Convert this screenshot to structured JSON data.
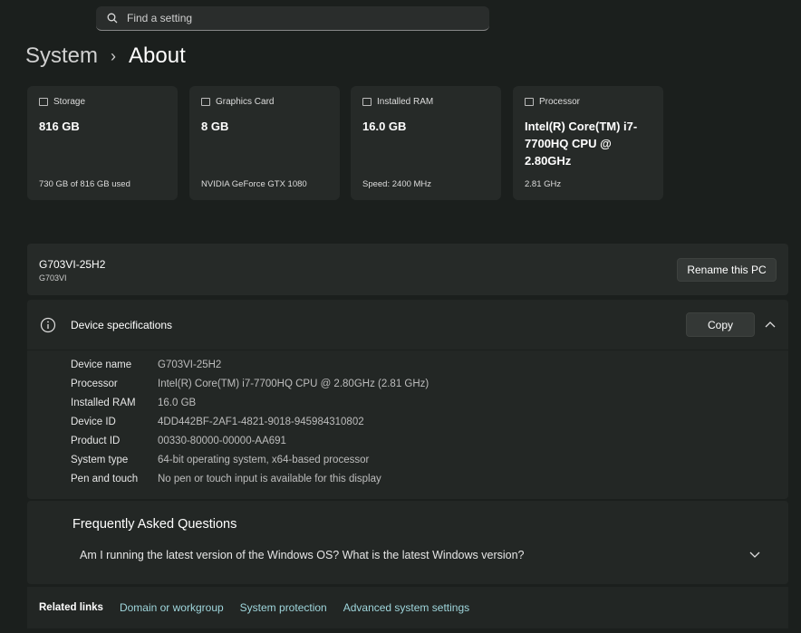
{
  "search": {
    "placeholder": "Find a setting"
  },
  "breadcrumb": {
    "parent": "System",
    "separator": "›",
    "current": "About"
  },
  "cards": [
    {
      "title": "Storage",
      "value": "816 GB",
      "sub": "730 GB of 816 GB used"
    },
    {
      "title": "Graphics Card",
      "value": "8 GB",
      "sub": "NVIDIA GeForce GTX 1080"
    },
    {
      "title": "Installed RAM",
      "value": "16.0 GB",
      "sub": "Speed: 2400 MHz"
    },
    {
      "title": "Processor",
      "value": "Intel(R) Core(TM) i7-7700HQ CPU @ 2.80GHz",
      "sub": "2.81 GHz"
    }
  ],
  "pc": {
    "name": "G703VI-25H2",
    "model": "G703VI",
    "rename_label": "Rename this PC"
  },
  "specs": {
    "title": "Device specifications",
    "copy_label": "Copy",
    "rows": [
      {
        "label": "Device name",
        "value": "G703VI-25H2"
      },
      {
        "label": "Processor",
        "value": "Intel(R) Core(TM) i7-7700HQ CPU @ 2.80GHz (2.81 GHz)"
      },
      {
        "label": "Installed RAM",
        "value": "16.0 GB"
      },
      {
        "label": "Device ID",
        "value": "4DD442BF-2AF1-4821-9018-945984310802"
      },
      {
        "label": "Product ID",
        "value": "00330-80000-00000-AA691"
      },
      {
        "label": "System type",
        "value": "64-bit operating system, x64-based processor"
      },
      {
        "label": "Pen and touch",
        "value": "No pen or touch input is available for this display"
      }
    ]
  },
  "faq": {
    "title": "Frequently Asked Questions",
    "question": "Am I running the latest version of the Windows OS? What is the latest Windows version?"
  },
  "related": {
    "label": "Related links",
    "links": [
      "Domain or workgroup",
      "System protection",
      "Advanced system settings"
    ]
  }
}
